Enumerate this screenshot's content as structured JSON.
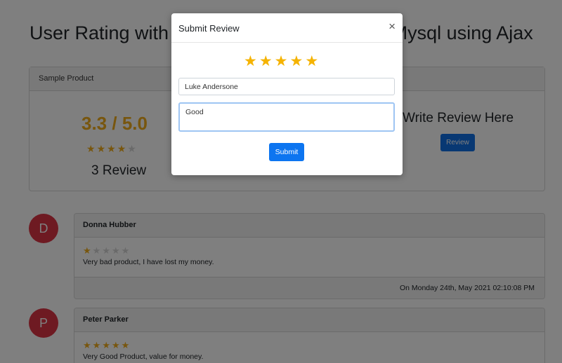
{
  "page": {
    "title": "User Rating with Review System in PHP & Mysql using Ajax"
  },
  "product": {
    "name": "Sample Product",
    "average_label": "3.3 / 5.0",
    "average_rating": 3.3,
    "rating_max": 5,
    "stars_filled": 4,
    "review_count_label": "3 Review",
    "write_review_label": "Write Review Here",
    "review_button_label": "Review"
  },
  "reviews": [
    {
      "initial": "D",
      "name": "Donna Hubber",
      "rating": 1,
      "text": "Very bad product, I have lost my money.",
      "timestamp": "On Monday 24th, May 2021 02:10:08 PM"
    },
    {
      "initial": "P",
      "name": "Peter Parker",
      "rating": 5,
      "text": "Very Good Product, value for money."
    }
  ],
  "modal": {
    "title": "Submit Review",
    "close_label": "×",
    "selected_rating": 5,
    "name_value": "Luke Andersone",
    "review_value": "Good",
    "submit_label": "Submit"
  },
  "colors": {
    "star": "#f0ad1c",
    "star_inactive": "#d4d4d4",
    "primary_button": "#0d75f0",
    "avatar": "#dc3545"
  },
  "icons": {
    "star": "star-icon",
    "close": "close-icon"
  }
}
